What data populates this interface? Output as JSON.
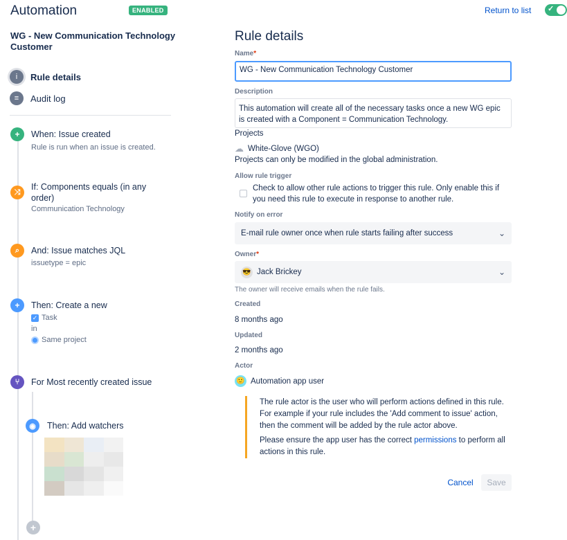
{
  "header": {
    "title": "Automation",
    "status_badge": "ENABLED",
    "return_link": "Return to list",
    "toggle_on": true
  },
  "sidebar": {
    "rule_name": "WG - New Communication Technology Customer",
    "nav": [
      {
        "label": "Rule details",
        "icon": "info-icon",
        "active": true
      },
      {
        "label": "Audit log",
        "icon": "list-icon",
        "active": false
      }
    ],
    "steps": [
      {
        "title": "When: Issue created",
        "sub": "Rule is run when an issue is created.",
        "icon": "plus-icon",
        "color": "#36b37e"
      },
      {
        "title": "If: Components equals (in any order)",
        "sub": "Communication Technology",
        "icon": "shuffle-icon",
        "color": "#ff991f"
      },
      {
        "title": "And: Issue matches JQL",
        "sub": "issuetype = epic",
        "icon": "search-icon",
        "color": "#ff991f"
      },
      {
        "title": "Then: Create a new",
        "sub_task": "Task",
        "sub_in": "in",
        "sub_project": "Same project",
        "icon": "plus-icon",
        "color": "#4c9aff"
      },
      {
        "title": "For Most recently created issue",
        "icon": "branch-icon",
        "color": "#6554c0"
      },
      {
        "title": "Then: Add watchers",
        "icon": "eye-icon",
        "color": "#4c9aff"
      }
    ]
  },
  "main": {
    "title": "Rule details",
    "name_label": "Name",
    "name_value": "WG - New Communication Technology Customer",
    "description_label": "Description",
    "description_value": "This automation will create all of the necessary tasks once a new WG epic is created with a Component = Communication Technology.",
    "projects_label": "Projects",
    "project_name": "White-Glove (WGO)",
    "projects_note": "Projects can only be modified in the global administration.",
    "allow_trigger_label": "Allow rule trigger",
    "allow_trigger_text": "Check to allow other rule actions to trigger this rule. Only enable this if you need this rule to execute in response to another rule.",
    "allow_trigger_checked": false,
    "notify_label": "Notify on error",
    "notify_value": "E-mail rule owner once when rule starts failing after success",
    "owner_label": "Owner",
    "owner_value": "Jack Brickey",
    "owner_helper": "The owner will receive emails when the rule fails.",
    "created_label": "Created",
    "created_value": "8 months ago",
    "updated_label": "Updated",
    "updated_value": "2 months ago",
    "actor_label": "Actor",
    "actor_value": "Automation app user",
    "info_p1": "The rule actor is the user who will perform actions defined in this rule. For example if your rule includes the 'Add comment to issue' action, then the comment will be added by the rule actor above.",
    "info_p2_pre": "Please ensure the app user has the correct ",
    "info_p2_link": "permissions",
    "info_p2_post": " to perform all actions in this rule.",
    "cancel_label": "Cancel",
    "save_label": "Save"
  },
  "colors": {
    "accent": "#0052cc",
    "success": "#36b37e",
    "warning": "#f5a623"
  }
}
